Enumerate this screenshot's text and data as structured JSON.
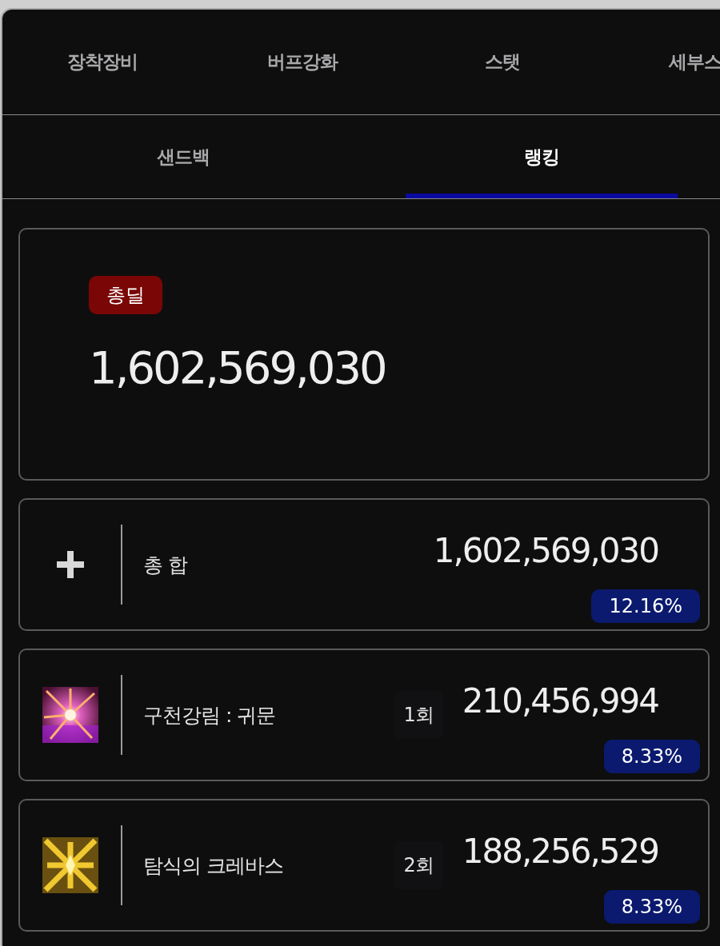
{
  "main_tabs": [
    {
      "label": "장착장비",
      "selected": false
    },
    {
      "label": "버프강화",
      "selected": false
    },
    {
      "label": "스탯",
      "selected": false
    },
    {
      "label": "세부스",
      "selected": false
    }
  ],
  "sub_tabs": [
    {
      "label": "샌드백",
      "selected": false
    },
    {
      "label": "랭킹",
      "selected": true
    }
  ],
  "summary": {
    "badge": "총딜",
    "value": "1,602,569,030"
  },
  "rows": [
    {
      "kind": "total",
      "name": "총 합",
      "value": "1,602,569,030",
      "percent": "12.16%"
    },
    {
      "kind": "skill",
      "name": "구천강림 : 귀문",
      "count": "1회",
      "value": "210,456,994",
      "percent": "8.33%"
    },
    {
      "kind": "skill",
      "name": "탐식의 크레바스",
      "count": "2회",
      "value": "188,256,529",
      "percent": "8.33%"
    }
  ]
}
